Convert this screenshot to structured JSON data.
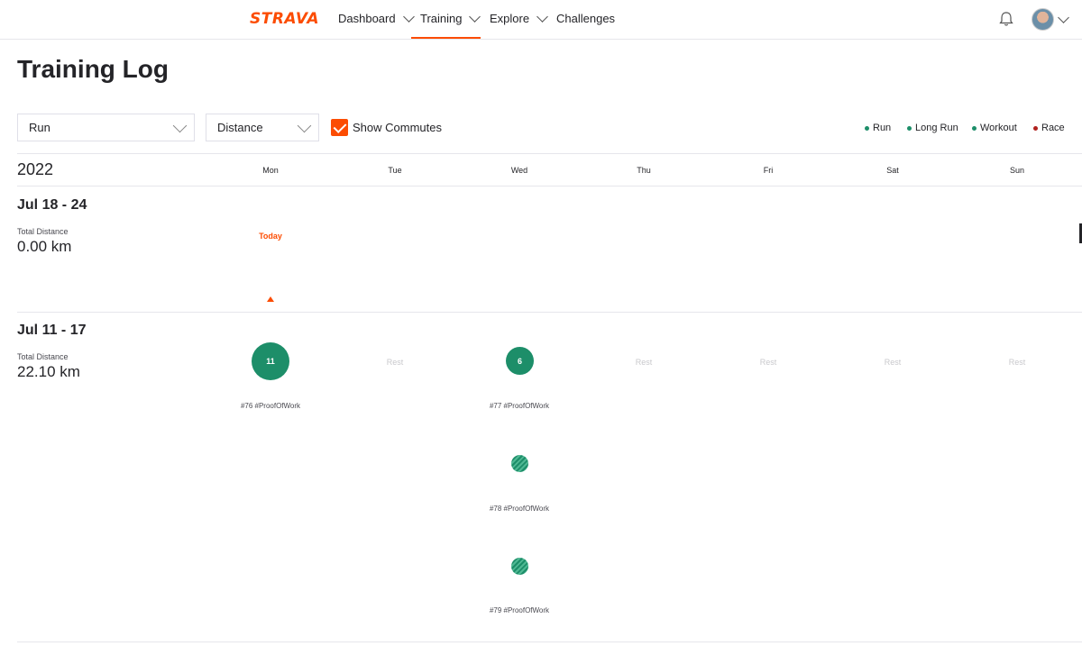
{
  "nav": {
    "logo": "STRAVA",
    "items": [
      "Dashboard",
      "Training",
      "Explore",
      "Challenges"
    ]
  },
  "page": {
    "title": "Training Log"
  },
  "filters": {
    "sport": "Run",
    "metric": "Distance",
    "show_commutes_label": "Show Commutes",
    "show_commutes_checked": true
  },
  "legend": [
    {
      "label": "Run",
      "color": "#1d8e69"
    },
    {
      "label": "Long Run",
      "color": "#1d8e69"
    },
    {
      "label": "Workout",
      "color": "#1d8e69"
    },
    {
      "label": "Race",
      "color": "#b0211e"
    }
  ],
  "calendar": {
    "year": "2022",
    "days": [
      "Mon",
      "Tue",
      "Wed",
      "Thu",
      "Fri",
      "Sat",
      "Sun"
    ],
    "today_label": "Today"
  },
  "weeks": [
    {
      "title": "Jul 18 - 24",
      "total_label": "Total Distance",
      "total_value": "0.00 km"
    },
    {
      "title": "Jul 11 - 17",
      "total_label": "Total Distance",
      "total_value": "22.10 km",
      "rest_label": "Rest",
      "activities": [
        {
          "day": "Mon",
          "value": "11",
          "label": "#76 #ProofOfWork"
        },
        {
          "day": "Wed",
          "value": "6",
          "label": "#77 #ProofOfWork"
        },
        {
          "day": "Wed",
          "value": "",
          "label": "#78 #ProofOfWork"
        },
        {
          "day": "Wed",
          "value": "",
          "label": "#79 #ProofOfWork"
        }
      ]
    }
  ],
  "colors": {
    "accent": "#fc4c02",
    "activity": "#1d8e69"
  }
}
